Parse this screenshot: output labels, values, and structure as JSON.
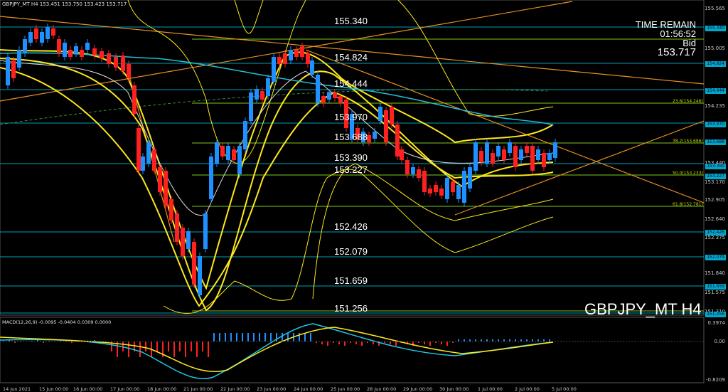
{
  "header": {
    "title": "GBPJPY_MT H4 153.451 153.750 153.423 153.717"
  },
  "info": {
    "time_remain_label": "TIME REMAIN",
    "time_remain": "01:56:52",
    "bid_label": "Bid",
    "bid": "153.717"
  },
  "watermark": "GBPJPY_MT H4",
  "macd_label": "MACD(12,26,9) -0.0095 -0.0404 0.0309 0.0000",
  "levels": [
    "155.340",
    "154.824",
    "154.444",
    "153.970",
    "153.688",
    "153.390",
    "153.227",
    "152.426",
    "152.079",
    "151.659",
    "151.256"
  ],
  "price_axis": [
    "155.565",
    "155.340",
    "155.005",
    "154.824",
    "154.444",
    "154.235",
    "153.970",
    "153.688",
    "153.440",
    "153.390",
    "153.227",
    "153.170",
    "152.905",
    "152.640",
    "152.426",
    "152.375",
    "152.079",
    "151.840",
    "151.659",
    "151.575",
    "151.310",
    "151.256"
  ],
  "macd_axis": [
    "0.3974",
    "0.00",
    "-0.8209"
  ],
  "time_axis": [
    "14 Jun 2021",
    "15 Jun 00:00",
    "16 Jun 00:00",
    "17 Jun 00:00",
    "18 Jun 00:00",
    "21 Jun 00:00",
    "22 Jun 00:00",
    "23 Jun 00:00",
    "24 Jun 00:00",
    "25 Jun 00:00",
    "28 Jun 00:00",
    "29 Jun 00:00",
    "30 Jun 00:00",
    "1 Jul 00:00",
    "2 Jul 00:00",
    "5 Jul 00:00"
  ],
  "fib_labels": [
    "23.6(154.246)",
    "38.2(153.686)",
    "50.0(153.233)",
    "61.8(152.781)"
  ],
  "colors": {
    "bull": "#1e90ff",
    "bear": "#ff2020",
    "level_line": "#00bcd4",
    "fib_line": "#9acd32",
    "band": "#ffe81a",
    "trend": "#e8a020",
    "macd_line": "#20c8e8",
    "signal": "#ffe81a"
  }
}
